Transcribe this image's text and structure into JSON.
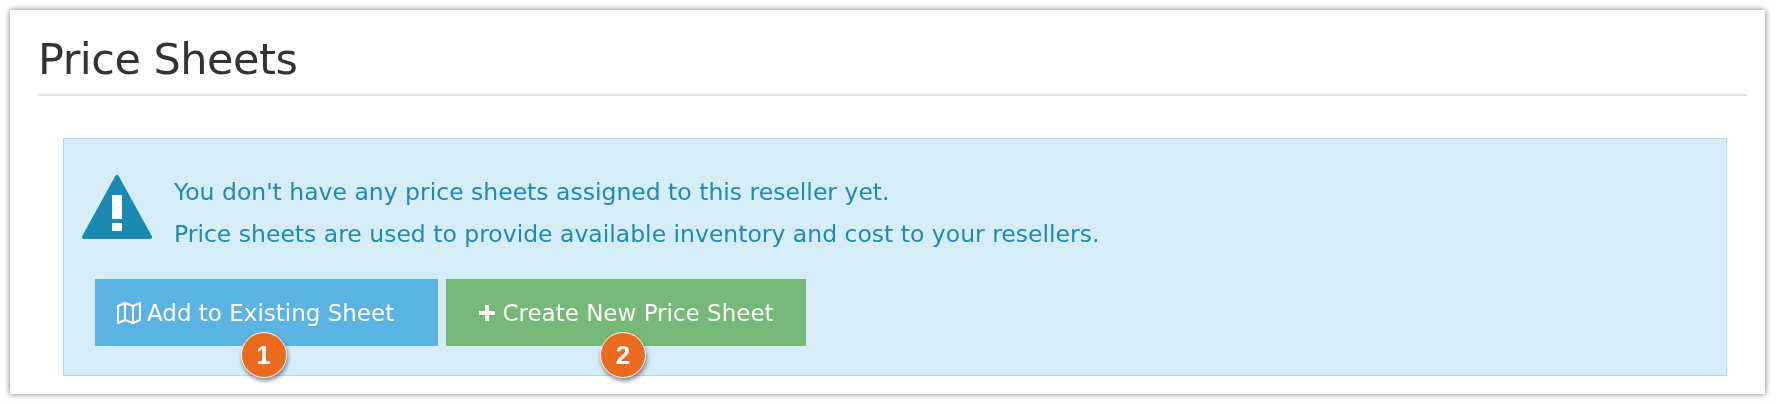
{
  "panel": {
    "title": "Price Sheets"
  },
  "alert": {
    "lines": [
      "You don't have any price sheets assigned to this reseller yet.",
      "Price sheets are used to provide available inventory and cost to your resellers."
    ]
  },
  "buttons": [
    {
      "label": "Add to Existing Sheet",
      "kind": "map",
      "badge": "1"
    },
    {
      "label": "Create New Price Sheet",
      "kind": "plus",
      "badge": "2"
    }
  ]
}
